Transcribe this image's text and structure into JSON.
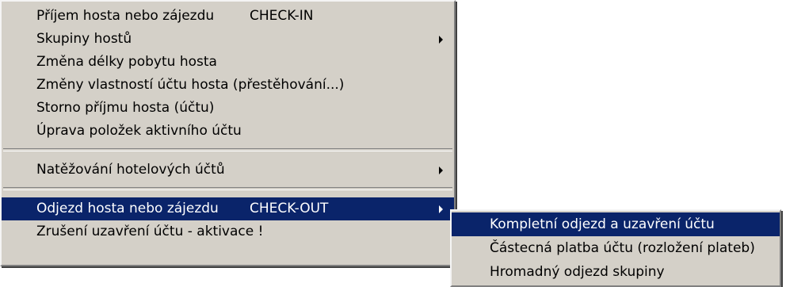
{
  "main_menu": {
    "items": [
      {
        "label": "Příjem hosta nebo zájezdu",
        "accel": "CHECK-IN"
      },
      {
        "label": "Skupiny hostů",
        "has_submenu": true
      },
      {
        "label": "Změna délky pobytu hosta"
      },
      {
        "label": "Změny vlastností účtu hosta (přestěhování...)"
      },
      {
        "label": "Storno příjmu hosta (účtu)"
      },
      {
        "label": "Úprava položek aktivního účtu"
      },
      {
        "label": "Natěžování hotelových účtů",
        "has_submenu": true
      },
      {
        "label": "Odjezd hosta nebo zájezdu",
        "accel": "CHECK-OUT",
        "has_submenu": true,
        "active": true
      },
      {
        "label": "Zrušení uzavření účtu - aktivace !"
      }
    ]
  },
  "sub_menu": {
    "items": [
      {
        "label": "Kompletní odjezd a uzavření účtu",
        "active": true
      },
      {
        "label": "Částecná platba účtu (rozložení plateb)"
      },
      {
        "label": "Hromadný odjezd skupiny"
      }
    ]
  },
  "colors": {
    "menu_bg": "#d4d0c8",
    "highlight_bg": "#0a246a",
    "highlight_text": "#ffffff",
    "text": "#000000"
  }
}
